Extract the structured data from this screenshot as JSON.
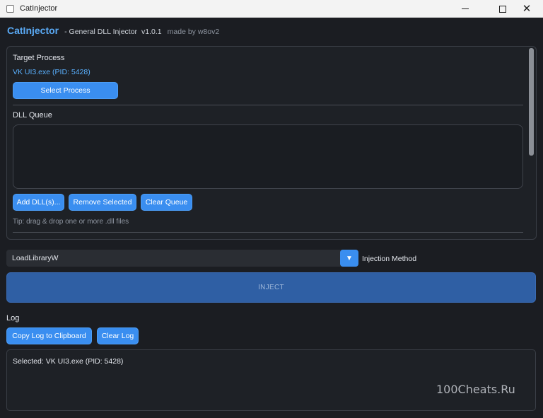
{
  "window": {
    "title": "CatInjector"
  },
  "header": {
    "brand": "CatInjector",
    "subtitle": "- General DLL Injector",
    "version": "v1.0.1",
    "author": "made by w8ov2"
  },
  "target": {
    "label": "Target Process",
    "value": "VK UI3.exe (PID: 5428)",
    "select_button": "Select Process"
  },
  "queue": {
    "label": "DLL Queue",
    "items": [],
    "add_button": "Add DLL(s)...",
    "remove_button": "Remove Selected",
    "clear_button": "Clear Queue",
    "tip": "Tip: drag & drop one or more .dll files"
  },
  "injection": {
    "selected_method": "LoadLibraryW",
    "method_label": "Injection Method",
    "inject_button": "INJECT"
  },
  "log": {
    "label": "Log",
    "copy_button": "Copy Log to Clipboard",
    "clear_button": "Clear Log",
    "lines": [
      "Selected: VK UI3.exe (PID: 5428)"
    ]
  },
  "watermark": "100Cheats.Ru",
  "colors": {
    "accent": "#3a8ef0",
    "brand": "#5aaaf5",
    "background": "#1b1d22",
    "link": "#5ab1ff"
  }
}
